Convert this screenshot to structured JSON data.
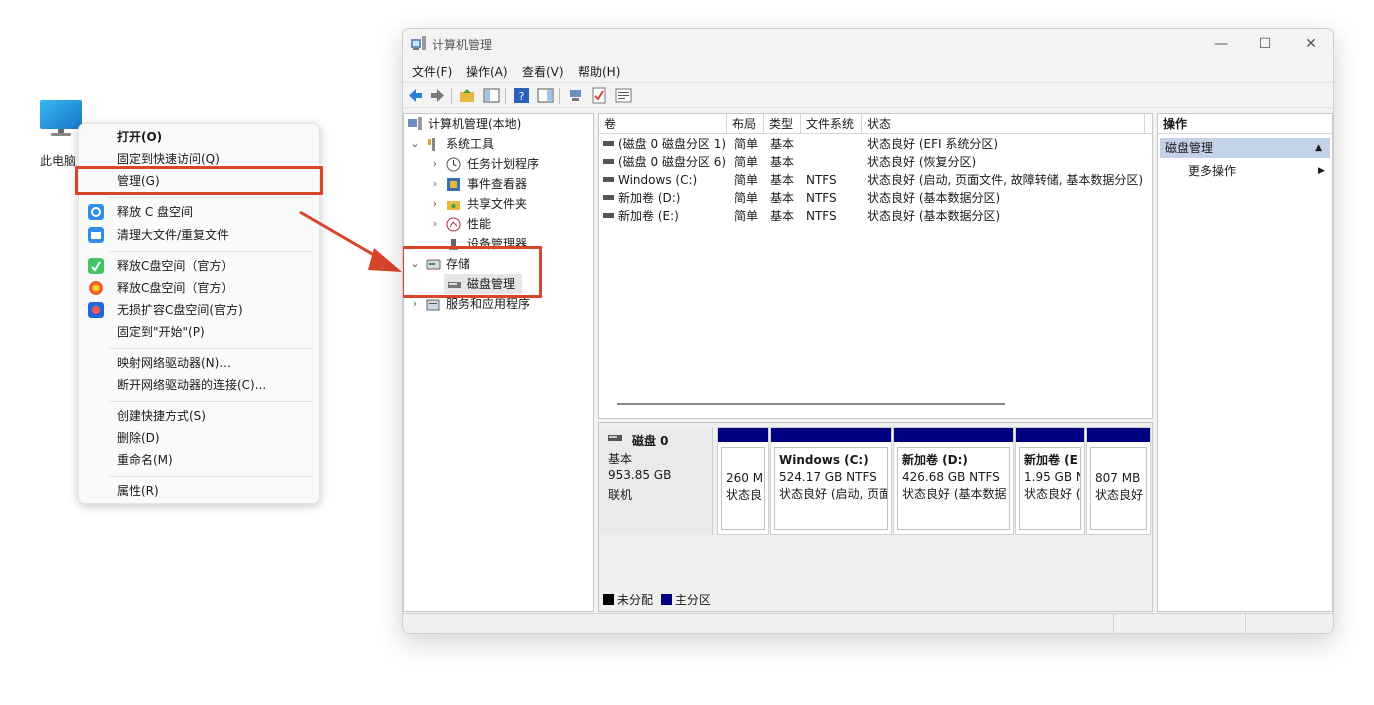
{
  "desktop": {
    "icon_label": "此电脑"
  },
  "context_menu": {
    "items": [
      {
        "label": "打开(O)",
        "bold": true
      },
      {
        "label": "固定到快速访问(Q)"
      },
      {
        "label": "管理(G)",
        "highlighted": true
      },
      {
        "label": "释放 C 盘空间",
        "icon": "clean-disk-icon"
      },
      {
        "label": "清理大文件/重复文件",
        "icon": "folder-clean-icon"
      },
      {
        "label": "释放C盘空间（官方）",
        "icon": "cleaner-app-icon"
      },
      {
        "label": "释放C盘空间（官方）",
        "icon": "optimizer-app-icon"
      },
      {
        "label": "无损扩容C盘空间(官方)",
        "icon": "partition-app-icon"
      },
      {
        "label": "固定到\"开始\"(P)"
      },
      {
        "label": "映射网络驱动器(N)..."
      },
      {
        "label": "断开网络驱动器的连接(C)..."
      },
      {
        "label": "创建快捷方式(S)"
      },
      {
        "label": "删除(D)"
      },
      {
        "label": "重命名(M)"
      },
      {
        "label": "属性(R)"
      }
    ]
  },
  "window": {
    "title": "计算机管理",
    "controls": {
      "minimize": "—",
      "maximize": "☐",
      "close": "✕"
    },
    "menus": [
      "文件(F)",
      "操作(A)",
      "查看(V)",
      "帮助(H)"
    ],
    "toolbar_icons": [
      "back-icon",
      "forward-icon",
      "up-folder-icon",
      "show-tree-icon",
      "help-icon",
      "show-action-pane-icon",
      "connect-icon",
      "check-icon",
      "properties-icon"
    ]
  },
  "tree": {
    "root": "计算机管理(本地)",
    "system_tools": "系统工具",
    "task_scheduler": "任务计划程序",
    "event_viewer": "事件查看器",
    "shared_folders": "共享文件夹",
    "performance": "性能",
    "device_manager": "设备管理器",
    "storage": "存储",
    "disk_management": "磁盘管理",
    "services_apps": "服务和应用程序"
  },
  "volume_list": {
    "headers": [
      "卷",
      "布局",
      "类型",
      "文件系统",
      "状态"
    ],
    "rows": [
      [
        "(磁盘 0 磁盘分区 1)",
        "简单",
        "基本",
        "",
        "状态良好 (EFI 系统分区)"
      ],
      [
        "(磁盘 0 磁盘分区 6)",
        "简单",
        "基本",
        "",
        "状态良好 (恢复分区)"
      ],
      [
        "Windows (C:)",
        "简单",
        "基本",
        "NTFS",
        "状态良好 (启动, 页面文件, 故障转储, 基本数据分区)"
      ],
      [
        "新加卷 (D:)",
        "简单",
        "基本",
        "NTFS",
        "状态良好 (基本数据分区)"
      ],
      [
        "新加卷 (E:)",
        "简单",
        "基本",
        "NTFS",
        "状态良好 (基本数据分区)"
      ]
    ]
  },
  "disk": {
    "name": "磁盘 0",
    "type": "基本",
    "size": "953.85 GB",
    "status": "联机",
    "partitions": [
      {
        "name": "",
        "size": "260 M",
        "status": "状态良"
      },
      {
        "name": "Windows  (C:)",
        "size": "524.17 GB NTFS",
        "status": "状态良好 (启动, 页面"
      },
      {
        "name": "新加卷  (D:)",
        "size": "426.68 GB NTFS",
        "status": "状态良好 (基本数据"
      },
      {
        "name": "新加卷  (E",
        "size": "1.95 GB N",
        "status": "状态良好 ("
      },
      {
        "name": "",
        "size": "807 MB",
        "status": "状态良好"
      }
    ],
    "partition_color": "#000080",
    "legend": [
      {
        "label": "未分配",
        "color": "#000000"
      },
      {
        "label": "主分区",
        "color": "#000080"
      }
    ]
  },
  "actions": {
    "header": "操作",
    "section": "磁盘管理",
    "more": "更多操作"
  },
  "colors": {
    "highlight_box": "#d9452b",
    "selection_band": "#c3d2e6"
  }
}
